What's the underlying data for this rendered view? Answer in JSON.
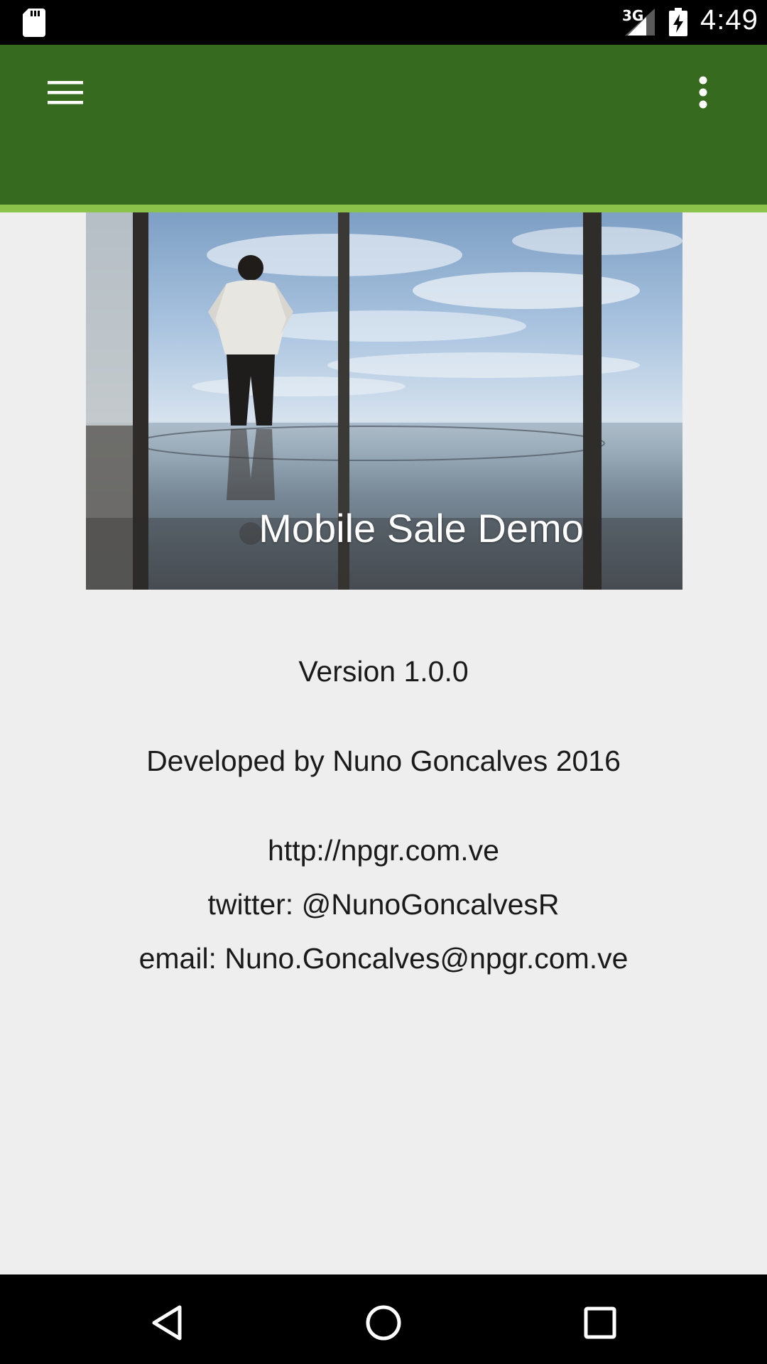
{
  "status_bar": {
    "network_type": "3G",
    "time": "4:49"
  },
  "app_bar": {
    "menu_icon": "hamburger-menu-icon",
    "overflow_icon": "more-vert-icon",
    "primary_color": "#356a1f",
    "accent_color": "#8bc34a"
  },
  "hero": {
    "title": "Mobile Sale Demo"
  },
  "about": {
    "version": "Version 1.0.0",
    "developer": "Developed by Nuno Goncalves 2016",
    "website": "http://npgr.com.ve",
    "twitter": "twitter: @NunoGoncalvesR",
    "email": "email: Nuno.Goncalves@npgr.com.ve"
  },
  "nav_bar": {
    "back_icon": "back-triangle-icon",
    "home_icon": "home-circle-icon",
    "recents_icon": "recents-square-icon"
  }
}
